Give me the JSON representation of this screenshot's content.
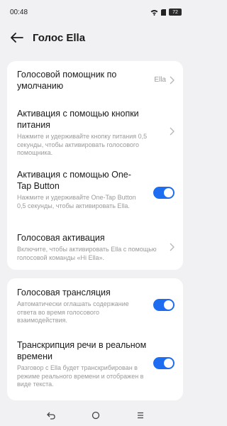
{
  "status_bar": {
    "time": "00:48",
    "battery": "72",
    "icons": [
      "wifi-icon",
      "sim-icon",
      "battery-icon"
    ]
  },
  "header": {
    "title": "Голос Ella",
    "back_icon": "arrow-left-icon"
  },
  "card1": {
    "default_assistant": {
      "title": "Голосовой помощник по умолчанию",
      "value": "Ella"
    },
    "power_button": {
      "title": "Активация с помощью кнопки питания",
      "desc": "Нажмите и удерживайте кнопку питания 0,5 секунды, чтобы активировать голосового помощника."
    },
    "one_tap": {
      "title": "Активация с помощью One-Tap Button",
      "desc": "Нажмите и удерживайте One-Tap Button 0,5 секунды, чтобы активировать Ella.",
      "enabled": true
    },
    "voice_activation": {
      "title": "Голосовая активация",
      "desc": "Включите, чтобы активировать Ella с помощью голосовой команды «Hi Ella»."
    }
  },
  "card2": {
    "voice_broadcast": {
      "title": "Голосовая трансляция",
      "desc": "Автоматически оглашать содержание ответа во время голосового взаимодействия.",
      "enabled": true
    },
    "transcription": {
      "title": "Транскрипция речи в реальном времени",
      "desc": "Разговор с Ella будет транскрибирован в режиме реального времени и отображен в виде текста.",
      "enabled": true
    }
  },
  "nav": {
    "back_icon": "nav-back-icon",
    "home_icon": "nav-home-icon",
    "recents_icon": "nav-recents-icon"
  },
  "colors": {
    "accent": "#1e6df0",
    "background": "#f1f1f3",
    "card": "#ffffff",
    "secondary_text": "#9a9a9a"
  }
}
